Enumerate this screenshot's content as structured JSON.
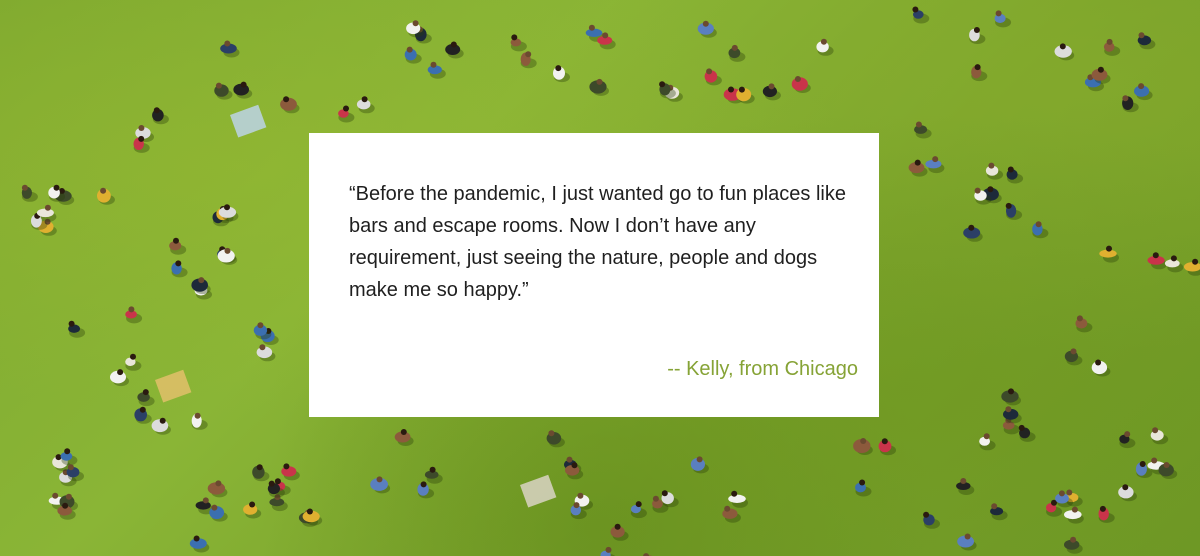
{
  "quote": {
    "text": "“Before the pandemic, I just wanted go to fun places like bars and escape rooms. Now I don’t have any requirement, just seeing the nature, people and dogs make me so happy.”",
    "attribution": "-- Kelly, from Chicago"
  },
  "background": {
    "description_icon": "park-crowd-aerial-photo",
    "grass_color": "#85b033",
    "accent_color": "#86a336"
  }
}
